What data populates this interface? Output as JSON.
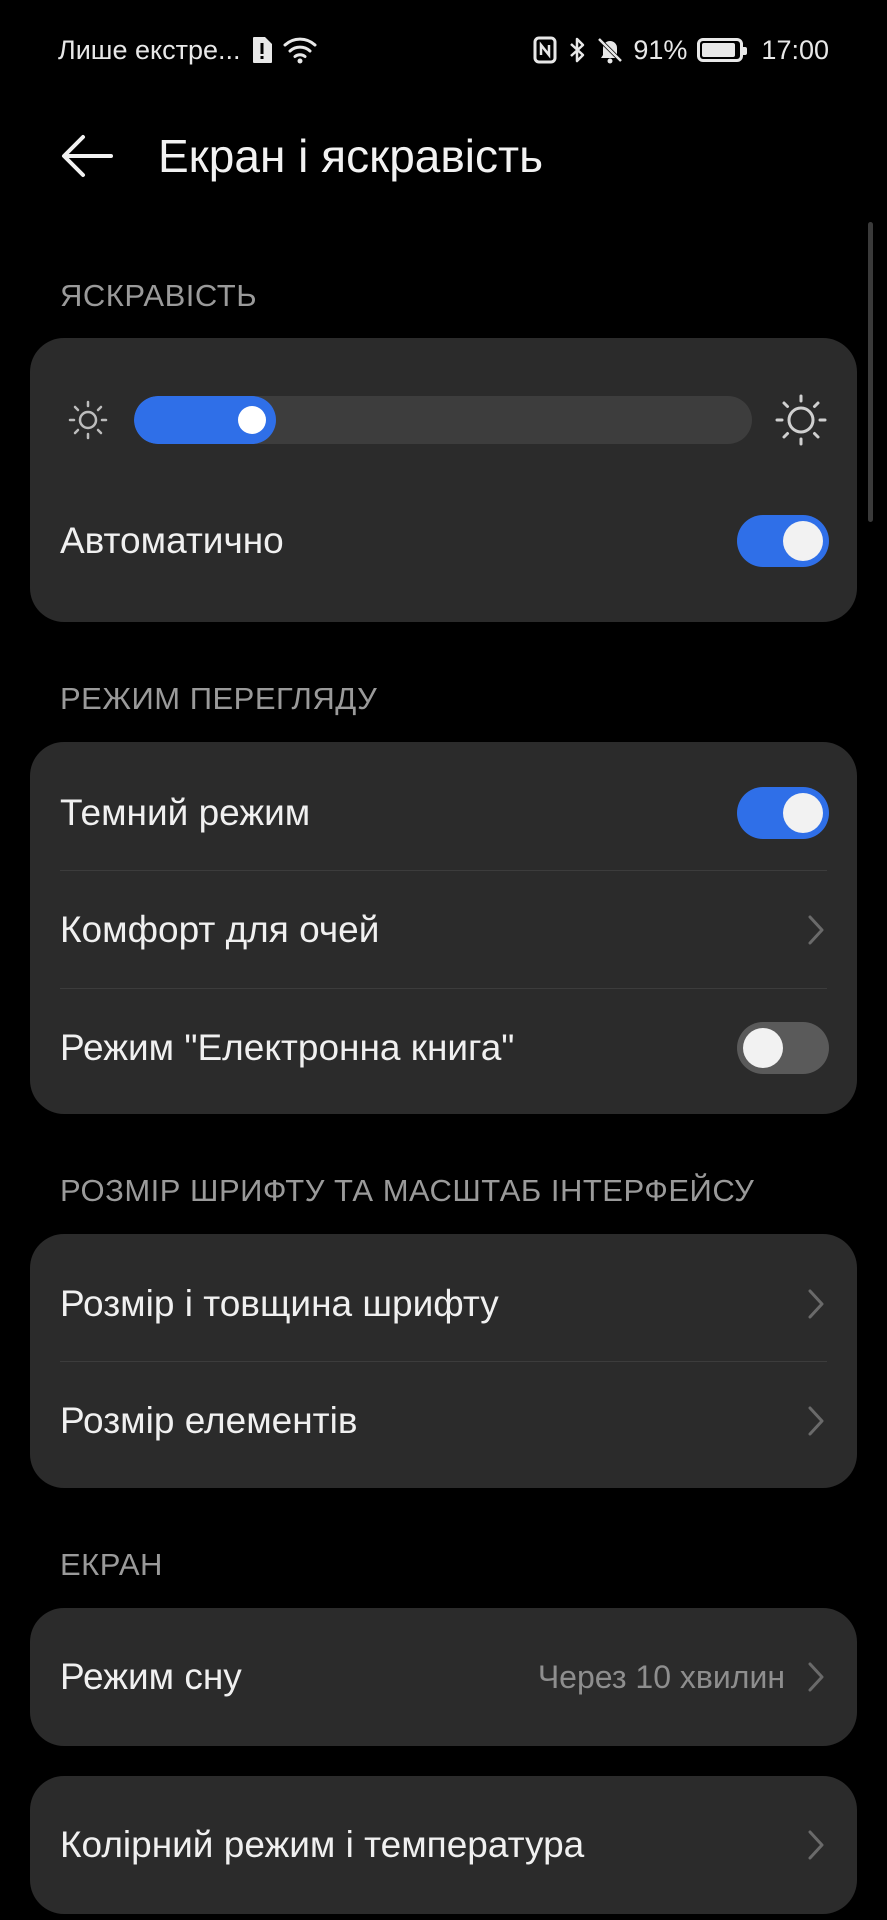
{
  "status_bar": {
    "carrier": "Лише екстре...",
    "battery_percent": "91%",
    "battery_level": 0.91,
    "time": "17:00"
  },
  "header": {
    "title": "Екран і яскравість"
  },
  "sections": {
    "brightness": {
      "label": "ЯСКРАВІСТЬ",
      "slider_level": 0.23,
      "auto_label": "Автоматично",
      "auto_on": true
    },
    "view_mode": {
      "label": "РЕЖИМ ПЕРЕГЛЯДУ",
      "dark_mode_label": "Темний режим",
      "dark_mode_on": true,
      "eye_comfort_label": "Комфорт для очей",
      "ebook_label": "Режим \"Електронна книга\"",
      "ebook_on": false
    },
    "font_scale": {
      "label": "РОЗМІР ШРИФТУ ТА МАСШТАБ ІНТЕРФЕЙСУ",
      "font_size_label": "Розмір і товщина шрифту",
      "element_size_label": "Розмір елементів"
    },
    "screen": {
      "label": "ЕКРАН",
      "sleep_label": "Режим сну",
      "sleep_value": "Через 10 хвилин",
      "color_mode_label": "Колірний режим і температура"
    }
  },
  "colors": {
    "accent": "#2f6fe8",
    "card": "#2b2b2b",
    "background": "#000000"
  }
}
